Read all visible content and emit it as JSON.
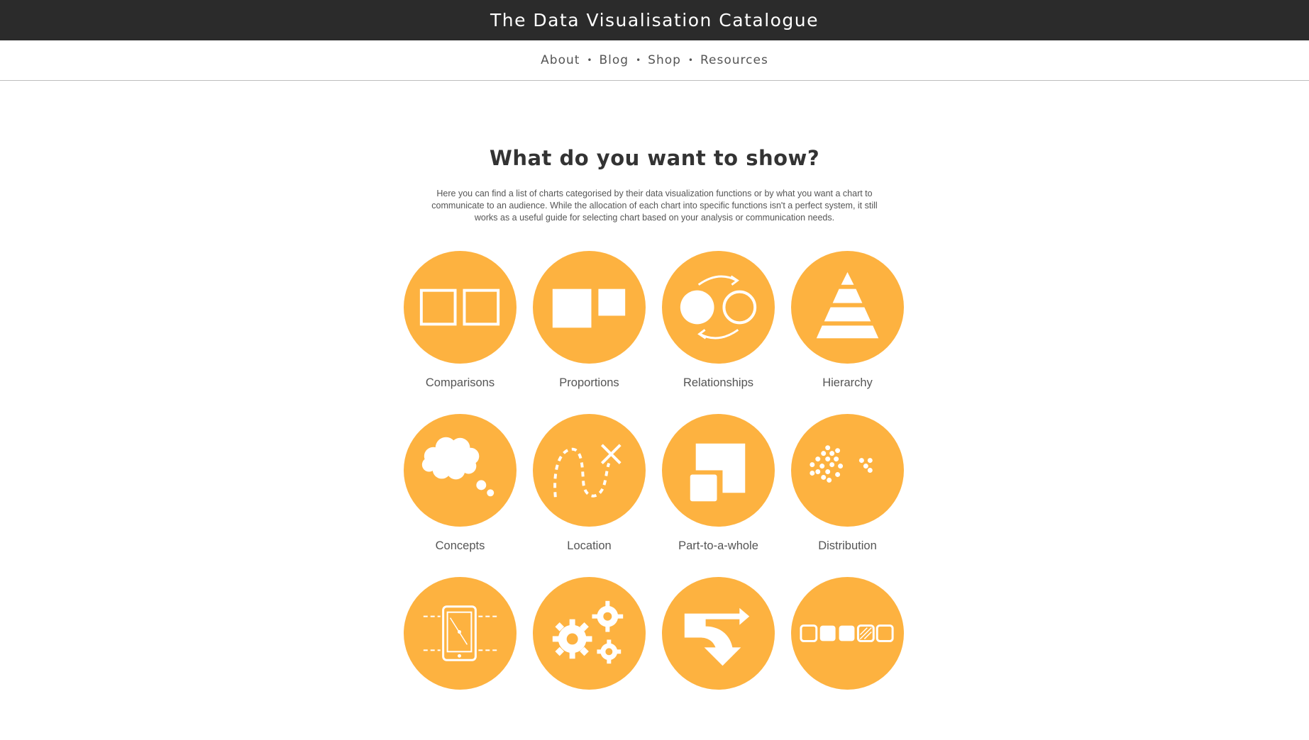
{
  "site": {
    "title": "The Data Visualisation Catalogue"
  },
  "nav": [
    {
      "label": "About"
    },
    {
      "label": "Blog"
    },
    {
      "label": "Shop"
    },
    {
      "label": "Resources"
    }
  ],
  "nav_separator": "•",
  "main": {
    "heading": "What do you want to show?",
    "intro": "Here you can find a list of charts categorised by their data visualization functions or by what you want a chart to communicate to an audience. While the allocation of each chart into specific functions isn't a perfect system, it still works as a useful guide for selecting chart based on your analysis or communication needs."
  },
  "categories": [
    {
      "label": "Comparisons",
      "icon": "comparisons-icon"
    },
    {
      "label": "Proportions",
      "icon": "proportions-icon"
    },
    {
      "label": "Relationships",
      "icon": "relationships-icon"
    },
    {
      "label": "Hierarchy",
      "icon": "hierarchy-icon"
    },
    {
      "label": "Concepts",
      "icon": "concepts-icon"
    },
    {
      "label": "Location",
      "icon": "location-icon"
    },
    {
      "label": "Part-to-a-whole",
      "icon": "part-to-a-whole-icon"
    },
    {
      "label": "Distribution",
      "icon": "distribution-icon"
    },
    {
      "label": "",
      "icon": "how-things-work-icon"
    },
    {
      "label": "",
      "icon": "processes-gears-icon"
    },
    {
      "label": "",
      "icon": "movement-flow-icon"
    },
    {
      "label": "",
      "icon": "patterns-icon"
    }
  ],
  "colors": {
    "accent": "#FDB240",
    "topbar": "#2b2b2b",
    "text": "#555555"
  }
}
